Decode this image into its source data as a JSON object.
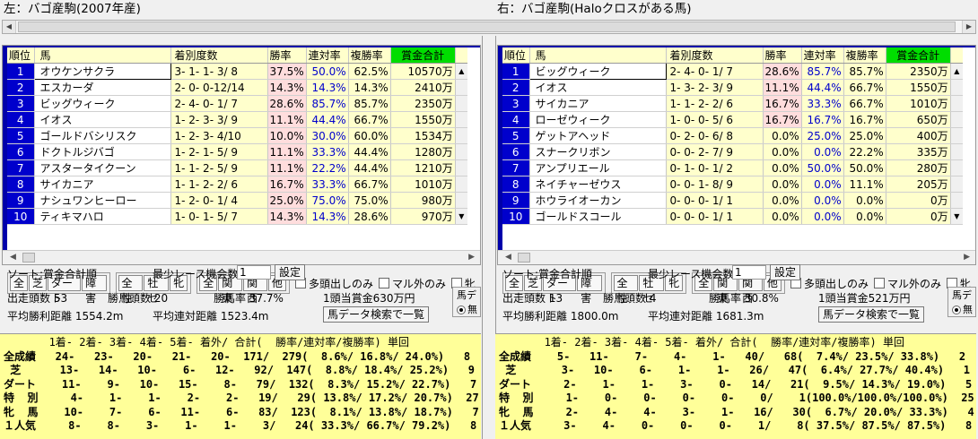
{
  "left": {
    "caption": "左：バゴ産駒(2007年産)",
    "headers": {
      "rank": "順位",
      "name": "馬",
      "dist": "着別度数",
      "win": "勝率",
      "ren": "連対率",
      "fuku": "複勝率",
      "prize": "賞金合計"
    },
    "rows": [
      {
        "rank": "1",
        "name": "オウケンサクラ",
        "dist": "3- 1- 1- 3/ 8",
        "win": "37.5%",
        "ren": "50.0%",
        "fuku": "62.5%",
        "prize": "10570万"
      },
      {
        "rank": "2",
        "name": "エスカーダ",
        "dist": "2- 0- 0-12/14",
        "win": "14.3%",
        "ren": "14.3%",
        "fuku": "14.3%",
        "prize": "2410万"
      },
      {
        "rank": "3",
        "name": "ビッグウィーク",
        "dist": "2- 4- 0- 1/ 7",
        "win": "28.6%",
        "ren": "85.7%",
        "fuku": "85.7%",
        "prize": "2350万"
      },
      {
        "rank": "4",
        "name": "イオス",
        "dist": "1- 2- 3- 3/ 9",
        "win": "11.1%",
        "ren": "44.4%",
        "fuku": "66.7%",
        "prize": "1550万"
      },
      {
        "rank": "5",
        "name": "ゴールドバシリスク",
        "dist": "1- 2- 3- 4/10",
        "win": "10.0%",
        "ren": "30.0%",
        "fuku": "60.0%",
        "prize": "1534万"
      },
      {
        "rank": "6",
        "name": "ドクトルジバゴ",
        "dist": "1- 2- 1- 5/ 9",
        "win": "11.1%",
        "ren": "33.3%",
        "fuku": "44.4%",
        "prize": "1280万"
      },
      {
        "rank": "7",
        "name": "アスタータイクーン",
        "dist": "1- 1- 2- 5/ 9",
        "win": "11.1%",
        "ren": "22.2%",
        "fuku": "44.4%",
        "prize": "1210万"
      },
      {
        "rank": "8",
        "name": "サイカニア",
        "dist": "1- 1- 2- 2/ 6",
        "win": "16.7%",
        "ren": "33.3%",
        "fuku": "66.7%",
        "prize": "1010万"
      },
      {
        "rank": "9",
        "name": "ナシュワンヒーロー",
        "dist": "1- 2- 0- 1/ 4",
        "win": "25.0%",
        "ren": "75.0%",
        "fuku": "75.0%",
        "prize": "980万"
      },
      {
        "rank": "10",
        "name": "ティキマハロ",
        "dist": "1- 0- 1- 5/ 7",
        "win": "14.3%",
        "ren": "14.3%",
        "fuku": "28.6%",
        "prize": "970万"
      }
    ],
    "b1": [
      "全",
      "芝",
      "ダート",
      "障害"
    ],
    "b2": [
      "全性",
      "牡セ",
      "牝"
    ],
    "b3": [
      "全",
      "関東",
      "関西",
      "他"
    ],
    "chk1": "多頭出しのみ",
    "chk2": "マル外のみ",
    "chk3": "牝",
    "sort": "ソート:賞金合計順",
    "min_label": "最少レース機会数",
    "min_value": "1",
    "set_btn": "設定",
    "starters": "出走頭数 53",
    "winners": "勝馬頭数 20",
    "win_ratio": "勝馬率 37.7%",
    "per_head": "1頭当賞金630万円",
    "avg_win": "平均勝利距離 1554.2m",
    "avg_ren": "平均連対距離 1523.4m",
    "search_btn": "馬データ検索で一覧",
    "radio_title": "馬デ",
    "radio_label": "無",
    "stats_header": "       1着- 2着- 3着- 4着- 5着- 着外/ 合計(  勝率/連対率/複勝率) 単回",
    "stats_rows": [
      "全成績   24-   23-   20-   21-   20-  171/  279(  8.6%/ 16.8%/ 24.0%)   8",
      " 芝      13-   14-   10-    6-   12-   92/  147(  8.8%/ 18.4%/ 25.2%)   9",
      "ダート    11-    9-   10-   15-    8-   79/  132(  8.3%/ 15.2%/ 22.7%)   7",
      "特  別     4-    1-    1-    2-    2-   19/   29( 13.8%/ 17.2%/ 20.7%)  27",
      "牝  馬    10-    7-    6-   11-    6-   83/  123(  8.1%/ 13.8%/ 18.7%)   7",
      "１人気     8-    8-    3-    1-    1-    3/   24( 33.3%/ 66.7%/ 79.2%)   8"
    ]
  },
  "right": {
    "caption": "右：バゴ産駒(Haloクロスがある馬)",
    "headers": {
      "rank": "順位",
      "name": "馬",
      "dist": "着別度数",
      "win": "勝率",
      "ren": "連対率",
      "fuku": "複勝率",
      "prize": "賞金合計"
    },
    "rows": [
      {
        "rank": "1",
        "name": "ビッグウィーク",
        "dist": "2- 4- 0- 1/ 7",
        "win": "28.6%",
        "ren": "85.7%",
        "fuku": "85.7%",
        "prize": "2350万"
      },
      {
        "rank": "2",
        "name": "イオス",
        "dist": "1- 3- 2- 3/ 9",
        "win": "11.1%",
        "ren": "44.4%",
        "fuku": "66.7%",
        "prize": "1550万"
      },
      {
        "rank": "3",
        "name": "サイカニア",
        "dist": "1- 1- 2- 2/ 6",
        "win": "16.7%",
        "ren": "33.3%",
        "fuku": "66.7%",
        "prize": "1010万"
      },
      {
        "rank": "4",
        "name": "ローゼウィーク",
        "dist": "1- 0- 0- 5/ 6",
        "win": "16.7%",
        "ren": "16.7%",
        "fuku": "16.7%",
        "prize": "650万"
      },
      {
        "rank": "5",
        "name": "ゲットアヘッド",
        "dist": "0- 2- 0- 6/ 8",
        "win": "0.0%",
        "ren": "25.0%",
        "fuku": "25.0%",
        "prize": "400万"
      },
      {
        "rank": "6",
        "name": "スナークリボン",
        "dist": "0- 0- 2- 7/ 9",
        "win": "0.0%",
        "ren": "0.0%",
        "fuku": "22.2%",
        "prize": "335万"
      },
      {
        "rank": "7",
        "name": "アンプリエール",
        "dist": "0- 1- 0- 1/ 2",
        "win": "0.0%",
        "ren": "50.0%",
        "fuku": "50.0%",
        "prize": "280万"
      },
      {
        "rank": "8",
        "name": "ネイチャーゼウス",
        "dist": "0- 0- 1- 8/ 9",
        "win": "0.0%",
        "ren": "0.0%",
        "fuku": "11.1%",
        "prize": "205万"
      },
      {
        "rank": "9",
        "name": "ホウライオーカン",
        "dist": "0- 0- 0- 1/ 1",
        "win": "0.0%",
        "ren": "0.0%",
        "fuku": "0.0%",
        "prize": "0万"
      },
      {
        "rank": "10",
        "name": "ゴールドスコール",
        "dist": "0- 0- 0- 1/ 1",
        "win": "0.0%",
        "ren": "0.0%",
        "fuku": "0.0%",
        "prize": "0万"
      }
    ],
    "b1": [
      "全",
      "芝",
      "ダート",
      "障害"
    ],
    "b2": [
      "全性",
      "牡セ",
      "牝"
    ],
    "b3": [
      "全",
      "関東",
      "関西",
      "他"
    ],
    "chk1": "多頭出しのみ",
    "chk2": "マル外のみ",
    "chk3": "牝",
    "sort": "ソート:賞金合計順",
    "min_label": "最少レース機会数",
    "min_value": "1",
    "set_btn": "設定",
    "starters": "出走頭数 13",
    "winners": "勝馬頭数 4",
    "win_ratio": "勝馬率 30.8%",
    "per_head": "1頭当賞金521万円",
    "avg_win": "平均勝利距離 1800.0m",
    "avg_ren": "平均連対距離 1681.3m",
    "search_btn": "馬データ検索で一覧",
    "radio_title": "馬デ",
    "radio_label": "無",
    "stats_header": "       1着- 2着- 3着- 4着- 5着- 着外/ 合計(  勝率/連対率/複勝率) 単回",
    "stats_rows": [
      "全成績    5-   11-    7-    4-    1-   40/   68(  7.4%/ 23.5%/ 33.8%)   2",
      " 芝       3-   10-    6-    1-    1-   26/   47(  6.4%/ 27.7%/ 40.4%)   1",
      "ダート     2-    1-    1-    3-    0-   14/   21(  9.5%/ 14.3%/ 19.0%)   5",
      "特  別     1-    0-    0-    0-    0-    0/    1(100.0%/100.0%/100.0%)  25",
      "牝  馬     2-    4-    4-    3-    1-   16/   30(  6.7%/ 20.0%/ 33.3%)   4",
      "１人気     3-    4-    0-    0-    0-    1/    8( 37.5%/ 87.5%/ 87.5%)   8"
    ]
  }
}
